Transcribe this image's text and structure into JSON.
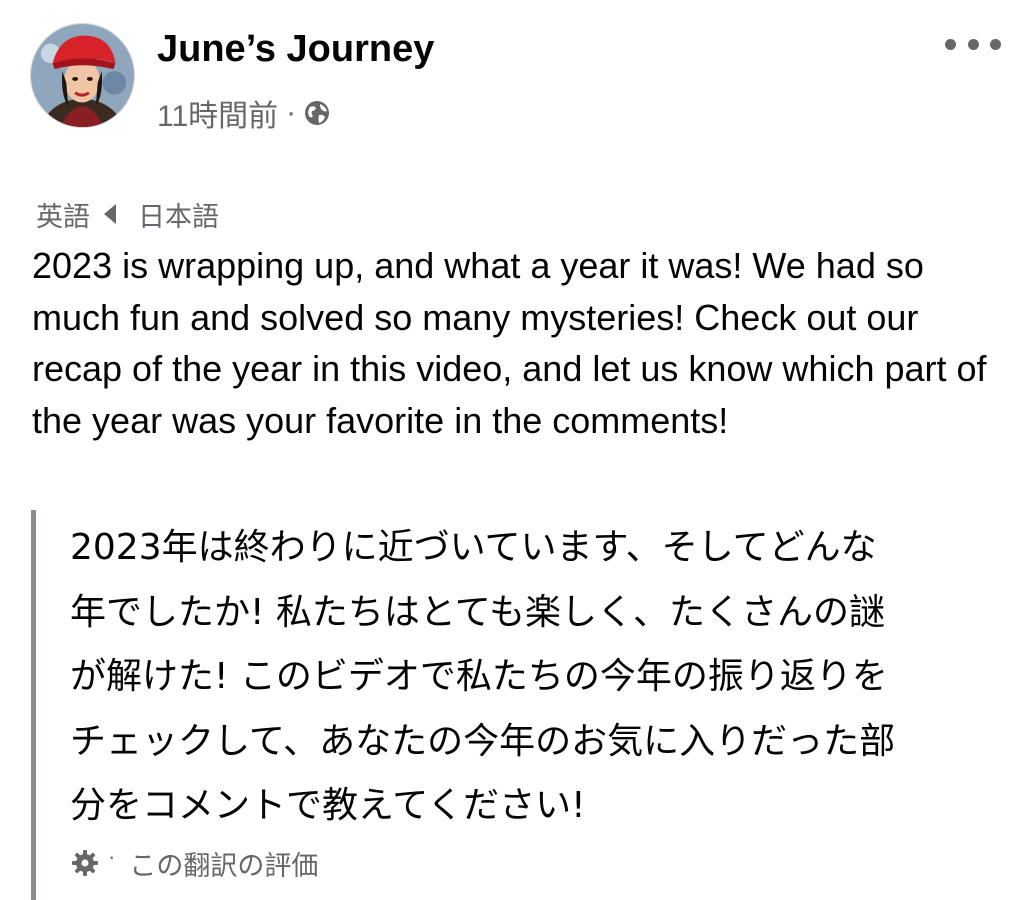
{
  "post": {
    "page_name": "June’s Journey",
    "time_label": "11時間前",
    "separator": "·",
    "privacy_icon": "globe-icon",
    "more_icon": "more-options-icon"
  },
  "language_toggle": {
    "source": "英語",
    "target": "日本語",
    "icon": "triangle-left-icon"
  },
  "body": {
    "original_text": "2023 is wrapping up, and what a year it was! We had so much fun and solved so many mysteries! Check out our recap of the year in this video, and let us know which part of the year was your favorite in the comments!",
    "translated_lines": [
      "2023年は終わりに近づいています、そしてどんな",
      "年でしたか! 私たちはとても楽しく、たくさんの謎",
      "が解けた! このビデオで私たちの今年の振り返りを",
      "チェックして、あなたの今年のお気に入りだった部",
      "分をコメントで教えてください!"
    ]
  },
  "translation_footer": {
    "rate_label": "この翻訳の評価",
    "separator": "·",
    "icon": "gear-icon"
  },
  "colors": {
    "text_primary": "#050505",
    "text_secondary": "#65676b",
    "quote_bar": "#8a8d91",
    "avatar_hat": "#d9232b"
  }
}
